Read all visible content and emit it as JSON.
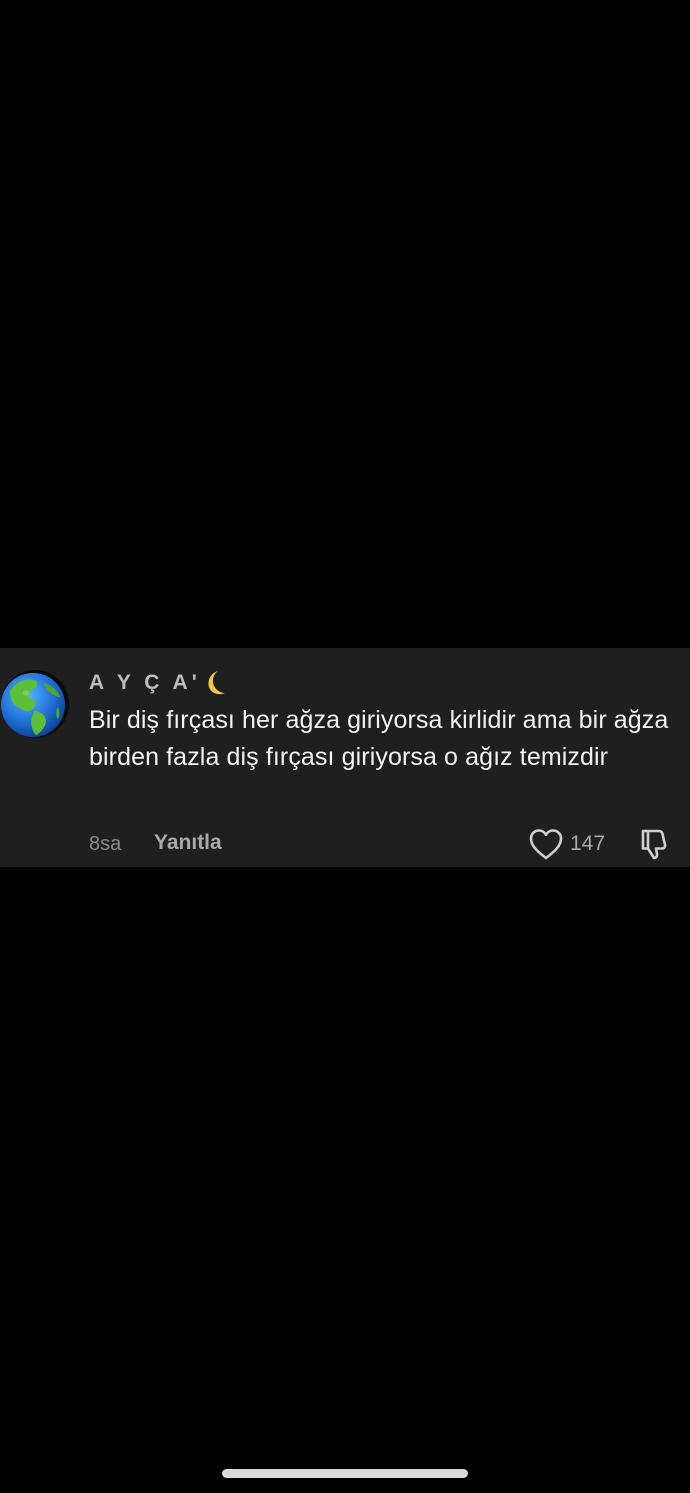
{
  "comment": {
    "username": "A Y Ç A'",
    "username_emoji": "crescent-moon-emoji",
    "avatar_icon": "earth-globe-americas-emoji",
    "text": "Bir diş fırçası her ağza giriyorsa kirlidir ama bir ağza birden fazla diş fırçası giriyorsa o ağız temizdir",
    "time": "8sa",
    "reply_label": "Yanıtla",
    "like_count": "147",
    "like_icon": "heart-outline-icon",
    "dislike_icon": "thumbs-down-outline-icon"
  },
  "colors": {
    "page_background": "#000000",
    "card_background": "#1f1f1f",
    "text_primary": "#f2f2f2",
    "text_secondary": "#a9a9a9"
  }
}
